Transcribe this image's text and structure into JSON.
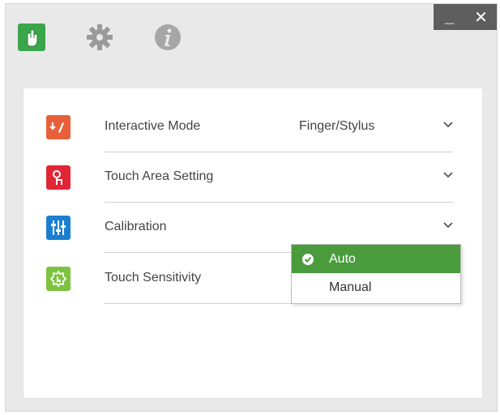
{
  "toolbar": {
    "icons": [
      "touch-hand-icon",
      "gear-icon",
      "info-icon"
    ],
    "active_color": "#3aa64a"
  },
  "window_controls": {
    "minimize": "_",
    "close": "✕"
  },
  "settings": [
    {
      "label": "Interactive Mode",
      "value": "Finger/Stylus",
      "icon": "interactive-mode-icon",
      "color": "#e8603a"
    },
    {
      "label": "Touch Area Setting",
      "value": "",
      "icon": "touch-area-icon",
      "color": "#e02535"
    },
    {
      "label": "Calibration",
      "value": "",
      "icon": "calibration-icon",
      "color": "#1b7fd0"
    },
    {
      "label": "Touch Sensitivity",
      "value": "",
      "icon": "touch-sensitivity-icon",
      "color": "#7cc33f"
    }
  ],
  "calibration_dropdown": {
    "options": [
      "Auto",
      "Manual"
    ],
    "selected": "Auto",
    "selected_color": "#4a9b3c"
  }
}
